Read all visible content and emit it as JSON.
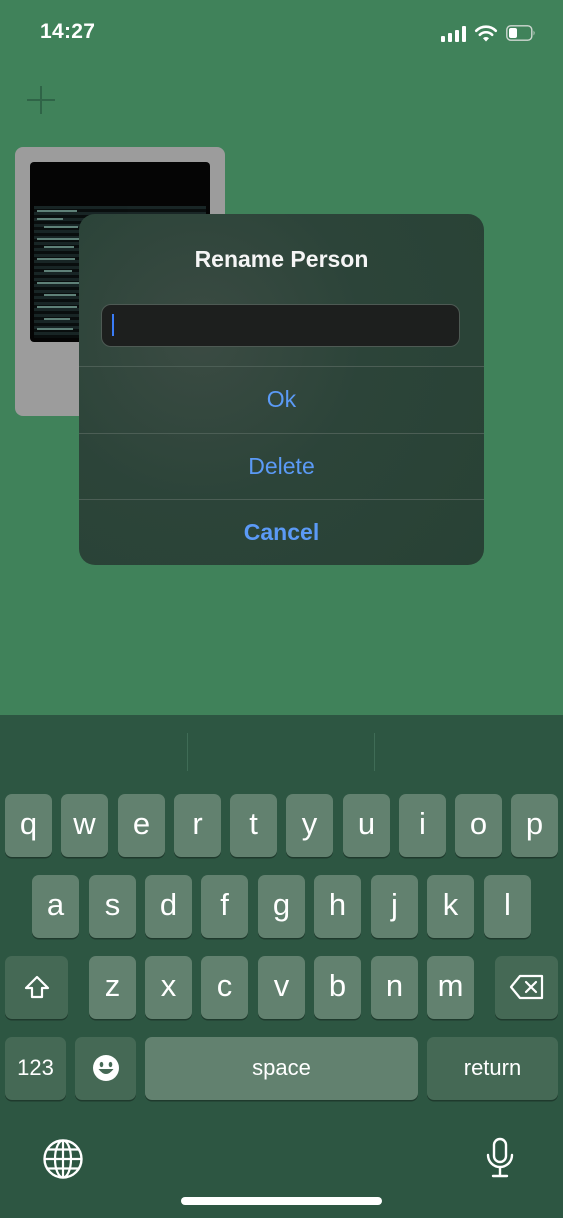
{
  "status_bar": {
    "time": "14:27"
  },
  "dialog": {
    "title": "Rename Person",
    "input_value": "",
    "buttons": {
      "ok": "Ok",
      "delete": "Delete",
      "cancel": "Cancel"
    }
  },
  "keyboard": {
    "row1": [
      "q",
      "w",
      "e",
      "r",
      "t",
      "y",
      "u",
      "i",
      "o",
      "p"
    ],
    "row2": [
      "a",
      "s",
      "d",
      "f",
      "g",
      "h",
      "j",
      "k",
      "l"
    ],
    "row3": [
      "z",
      "x",
      "c",
      "v",
      "b",
      "n",
      "m"
    ],
    "numbers_label": "123",
    "space_label": "space",
    "return_label": "return"
  },
  "colors": {
    "background": "#40825a",
    "accent": "#5b9af6",
    "keyboard": "#2d5642"
  },
  "icons": [
    "plus-icon",
    "signal-icon",
    "wifi-icon",
    "battery-icon",
    "shift-icon",
    "backspace-icon",
    "emoji-icon",
    "globe-icon",
    "microphone-icon"
  ]
}
